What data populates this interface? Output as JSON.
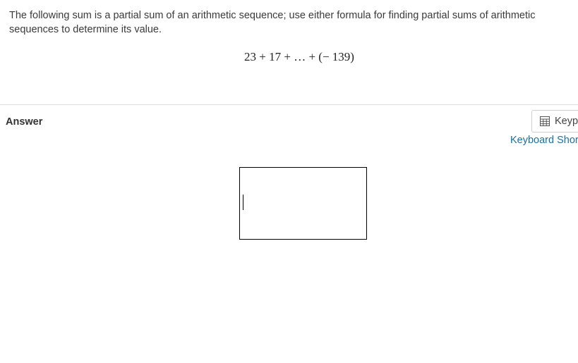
{
  "question": {
    "text": "The following sum is a partial sum of an arithmetic sequence; use either formula for finding partial sums of arithmetic sequences to determine its value.",
    "expression": "23 + 17 + … + (− 139)"
  },
  "answer": {
    "label": "Answer",
    "input_value": ""
  },
  "tools": {
    "keypad_label": "Keypad",
    "keypad_icon": "calculator-icon",
    "shortcuts_label": "Keyboard Shortcuts"
  },
  "colors": {
    "link": "#1a6fa6",
    "divider": "#dcdcdc"
  }
}
